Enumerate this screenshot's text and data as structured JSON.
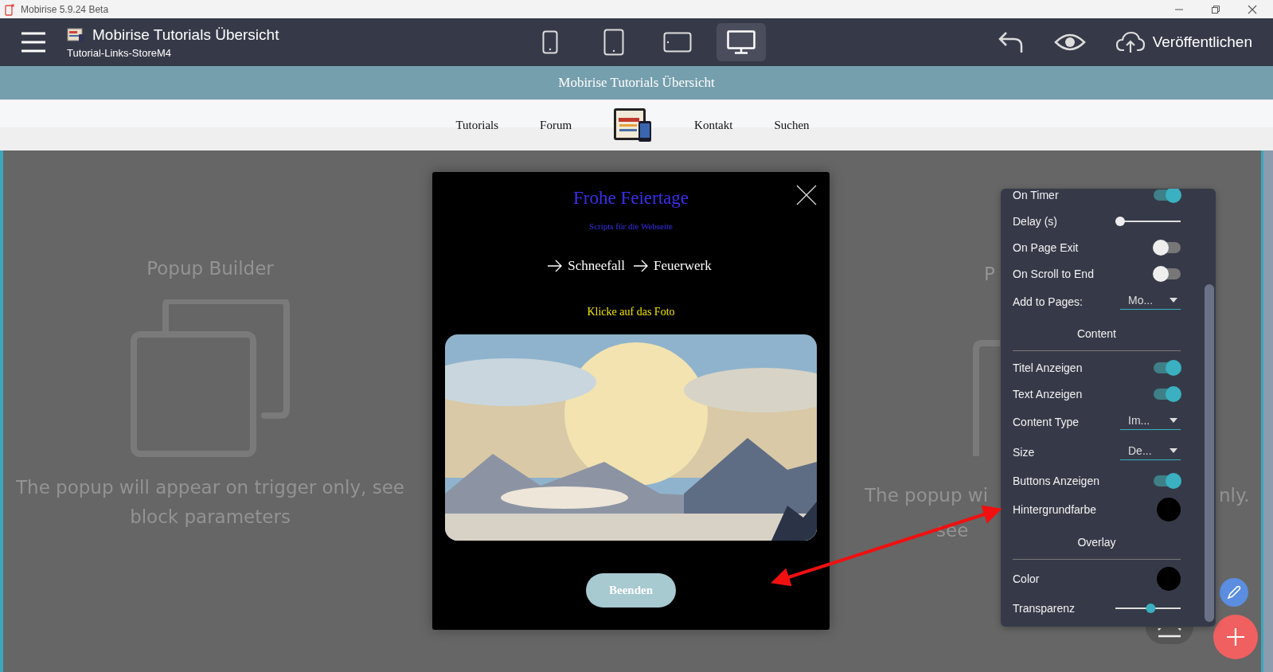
{
  "window": {
    "title": "Mobirise 5.9.24 Beta"
  },
  "toolbar": {
    "project_title": "Mobirise Tutorials Übersicht",
    "project_subtitle": "Tutorial-Links-StoreM4",
    "devices": [
      {
        "kind": "phone",
        "selected": false
      },
      {
        "kind": "tablet",
        "selected": false
      },
      {
        "kind": "landscape",
        "selected": false
      },
      {
        "kind": "desktop",
        "selected": true
      }
    ],
    "publish_label": "Veröffentlichen"
  },
  "site": {
    "banner": "Mobirise Tutorials Übersicht",
    "nav": [
      {
        "kind": "link",
        "label": "Tutorials"
      },
      {
        "kind": "link",
        "label": "Forum"
      },
      {
        "kind": "picture"
      },
      {
        "kind": "link",
        "label": "Kontakt"
      },
      {
        "kind": "link",
        "label": "Suchen"
      }
    ]
  },
  "placeholder": {
    "title": "Popup Builder",
    "text": "The popup will appear on trigger only, see block parameters"
  },
  "placeholder_right": {
    "title_fragment": "P",
    "line1_start": "The popup wi",
    "line1_end": "nly.",
    "line2_start": "see"
  },
  "popup": {
    "title": "Frohe Feiertage",
    "subtitle": "Scripts für die Webseite",
    "links": [
      "Schneefall",
      "Feuerwerk"
    ],
    "hint": "Klicke auf das Foto",
    "button": "Beenden"
  },
  "settings": [
    {
      "kind": "toggle",
      "label": "On Timer",
      "on": true
    },
    {
      "kind": "slider",
      "label": "Delay (s)",
      "level": 0
    },
    {
      "kind": "toggle",
      "label": "On Page Exit",
      "on": false
    },
    {
      "kind": "toggle",
      "label": "On Scroll to End",
      "on": false
    },
    {
      "kind": "select",
      "label": "Add to Pages:",
      "value": "Mo..."
    },
    {
      "kind": "heading",
      "label": "Content"
    },
    {
      "kind": "toggle",
      "label": "Titel Anzeigen",
      "on": true
    },
    {
      "kind": "toggle",
      "label": "Text Anzeigen",
      "on": true
    },
    {
      "kind": "select",
      "label": "Content Type",
      "value": "Im..."
    },
    {
      "kind": "select",
      "label": "Size",
      "value": "De..."
    },
    {
      "kind": "toggle",
      "label": "Buttons Anzeigen",
      "on": true
    },
    {
      "kind": "color",
      "label": "Hintergrundfarbe",
      "color": "#000000"
    },
    {
      "kind": "heading",
      "label": "Overlay"
    },
    {
      "kind": "color",
      "label": "Color",
      "color": "#000000"
    },
    {
      "kind": "slider",
      "label": "Transparenz",
      "level": 0.55
    }
  ]
}
